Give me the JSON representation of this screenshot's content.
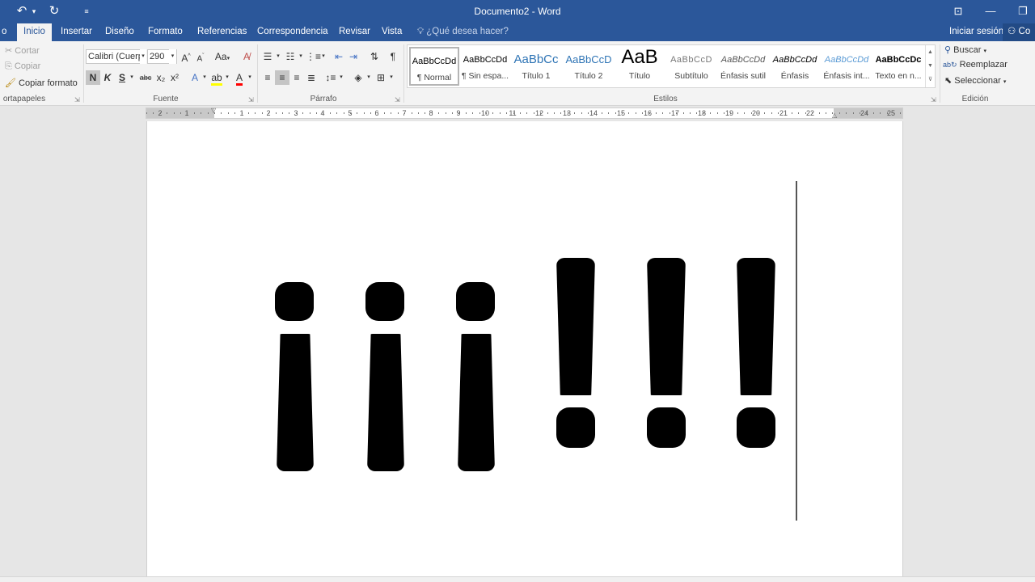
{
  "window": {
    "title": "Documento2 - Word",
    "qat": {
      "undo_icon": "undo-icon",
      "redo_icon": "redo-icon",
      "customize_icon": "customize-qat-icon"
    }
  },
  "tabs": [
    {
      "label": "o"
    },
    {
      "label": "Inicio"
    },
    {
      "label": "Insertar"
    },
    {
      "label": "Diseño"
    },
    {
      "label": "Formato"
    },
    {
      "label": "Referencias"
    },
    {
      "label": "Correspondencia"
    },
    {
      "label": "Revisar"
    },
    {
      "label": "Vista"
    }
  ],
  "tell_me": "¿Qué desea hacer?",
  "sign_in": "Iniciar sesión",
  "share": "Co",
  "clipboard": {
    "cut": "Cortar",
    "copy": "Copiar",
    "format_painter": "Copiar formato",
    "label": "ortapapeles"
  },
  "font": {
    "name": "Calibri (Cuerp",
    "size": "290",
    "bold": "N",
    "italic": "K",
    "underline": "S",
    "strike": "abc",
    "sub": "x₂",
    "sup": "x²",
    "case": "Aa",
    "label": "Fuente"
  },
  "paragraph": {
    "label": "Párrafo"
  },
  "styles": {
    "label": "Estilos",
    "items": [
      {
        "preview": "AaBbCcDd",
        "name": "¶ Normal"
      },
      {
        "preview": "AaBbCcDd",
        "name": "¶ Sin espa..."
      },
      {
        "preview": "AaBbCc",
        "name": "Título 1"
      },
      {
        "preview": "AaBbCcD",
        "name": "Título 2"
      },
      {
        "preview": "AaB",
        "name": "Título"
      },
      {
        "preview": "AaBbCcD",
        "name": "Subtítulo"
      },
      {
        "preview": "AaBbCcDd",
        "name": "Énfasis sutil"
      },
      {
        "preview": "AaBbCcDd",
        "name": "Énfasis"
      },
      {
        "preview": "AaBbCcDd",
        "name": "Énfasis int..."
      },
      {
        "preview": "AaBbCcDc",
        "name": "Texto en n..."
      }
    ]
  },
  "editing": {
    "find": "Buscar",
    "replace": "Reemplazar",
    "select": "Seleccionar",
    "label": "Edición"
  },
  "ruler": {
    "labels": [
      "2",
      "1",
      "1",
      "2",
      "3",
      "4",
      "5",
      "6",
      "7",
      "8",
      "9",
      "10",
      "11",
      "12",
      "13",
      "14",
      "15",
      "16",
      "17",
      "18",
      "19",
      "20",
      "21",
      "22",
      "24",
      "25"
    ]
  },
  "document": {
    "content": "¡¡¡!!!"
  },
  "colors": {
    "accent": "#2b579a",
    "highlight": "#ffff00",
    "font_color": "#ff0000"
  }
}
